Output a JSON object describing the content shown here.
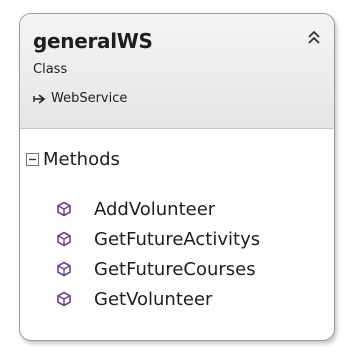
{
  "class_box": {
    "name": "generalWS",
    "stereotype": "Class",
    "base_type": "WebService",
    "collapse_icon": "double-chevron-up-icon",
    "inherit_icon": "inheritance-arrow-icon"
  },
  "methods_section": {
    "title": "Methods",
    "toggle_icon": "collapse-minus-icon",
    "items": [
      {
        "label": "AddVolunteer",
        "icon": "method-cube-icon"
      },
      {
        "label": "GetFutureActivitys",
        "icon": "method-cube-icon"
      },
      {
        "label": "GetFutureCourses",
        "icon": "method-cube-icon"
      },
      {
        "label": "GetVolunteer",
        "icon": "method-cube-icon"
      }
    ]
  },
  "colors": {
    "method_icon": "#6c3f8f",
    "border": "#9a9a9a",
    "text": "#1e1e1e"
  }
}
